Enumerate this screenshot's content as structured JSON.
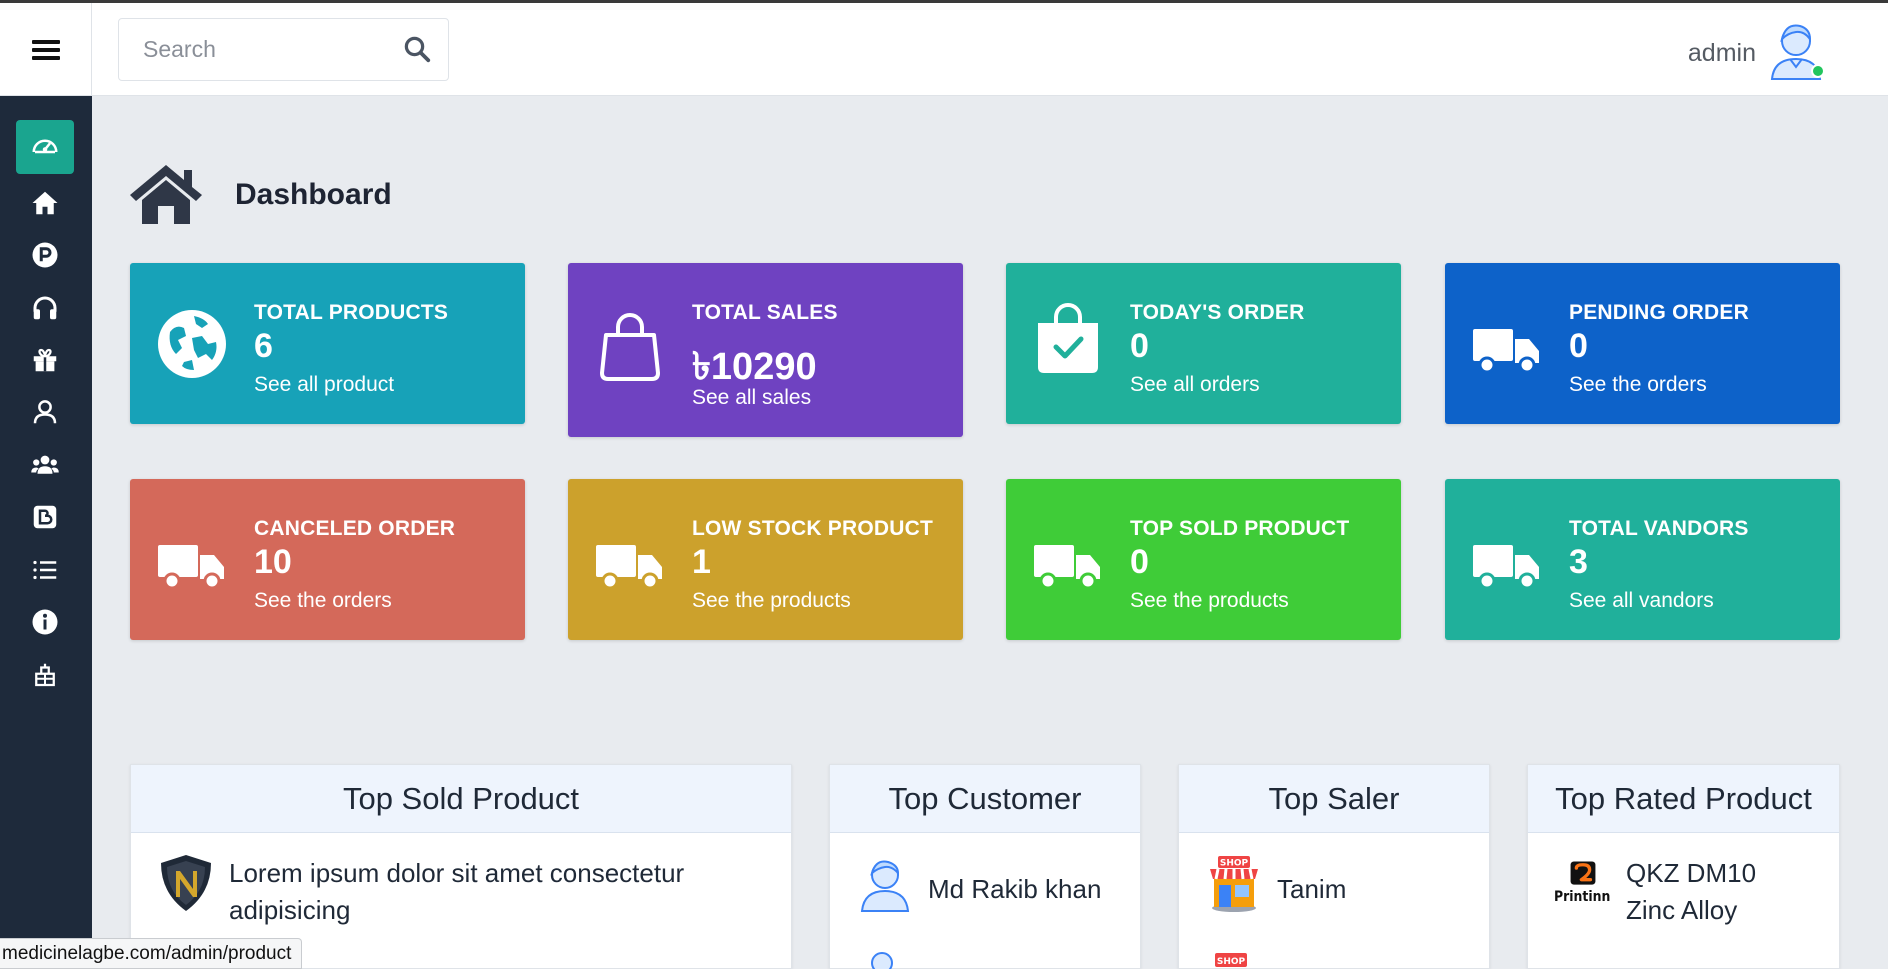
{
  "header": {
    "search_placeholder": "Search",
    "user_name": "admin",
    "status_color": "#22c55e"
  },
  "sidebar": {
    "items": [
      {
        "icon": "dashboard-gauge-icon",
        "active": true
      },
      {
        "icon": "home-icon"
      },
      {
        "icon": "product-p-icon"
      },
      {
        "icon": "headphones-icon"
      },
      {
        "icon": "gift-icon"
      },
      {
        "icon": "user-icon"
      },
      {
        "icon": "users-group-icon"
      },
      {
        "icon": "blog-icon"
      },
      {
        "icon": "list-icon"
      },
      {
        "icon": "info-icon"
      },
      {
        "icon": "settings-building-icon"
      }
    ]
  },
  "page": {
    "title": "Dashboard"
  },
  "cards": [
    {
      "title": "TOTAL PRODUCTS",
      "value": "6",
      "link": "See all product",
      "color": "#17a2b8",
      "icon": "globe-icon"
    },
    {
      "title": "TOTAL SALES",
      "value": "৳10290",
      "link": "See all sales",
      "color": "#6f42c1",
      "icon": "shopping-bag-icon"
    },
    {
      "title": "TODAY'S ORDER",
      "value": "0",
      "link": "See all orders",
      "color": "#20b09b",
      "icon": "bag-check-icon"
    },
    {
      "title": "PENDING ORDER",
      "value": "0",
      "link": "See the orders",
      "color": "#0d62c9",
      "icon": "truck-icon"
    },
    {
      "title": "CANCELED ORDER",
      "value": "10",
      "link": "See the orders",
      "color": "#d4695a",
      "icon": "truck-icon"
    },
    {
      "title": "LOW STOCK PRODUCT",
      "value": "1",
      "link": "See the products",
      "color": "#cca12c",
      "icon": "truck-icon"
    },
    {
      "title": "TOP SOLD PRODUCT",
      "value": "0",
      "link": "See the products",
      "color": "#3fcc38",
      "icon": "truck-icon"
    },
    {
      "title": "TOTAL VANDORS",
      "value": "3",
      "link": "See all vandors",
      "color": "#20b09b",
      "icon": "truck-icon"
    }
  ],
  "panels": {
    "top_sold": {
      "title": "Top Sold Product",
      "items": [
        {
          "text": "Lorem ipsum dolor sit amet consectetur adipisicing",
          "thumb": "shield-logo-icon"
        }
      ]
    },
    "top_customer": {
      "title": "Top Customer",
      "items": [
        {
          "text": "Md Rakib khan",
          "thumb": "person-avatar-icon"
        }
      ]
    },
    "top_saler": {
      "title": "Top Saler",
      "items": [
        {
          "text": "Tanim",
          "thumb": "shop-icon"
        }
      ]
    },
    "top_rated": {
      "title": "Top Rated Product",
      "items": [
        {
          "text": "QKZ DM10 Zinc Alloy",
          "thumb": "printinn-logo-icon",
          "logo_text": "Printinn"
        }
      ]
    }
  },
  "statusbar": {
    "url": "medicinelagbe.com/admin/product"
  }
}
